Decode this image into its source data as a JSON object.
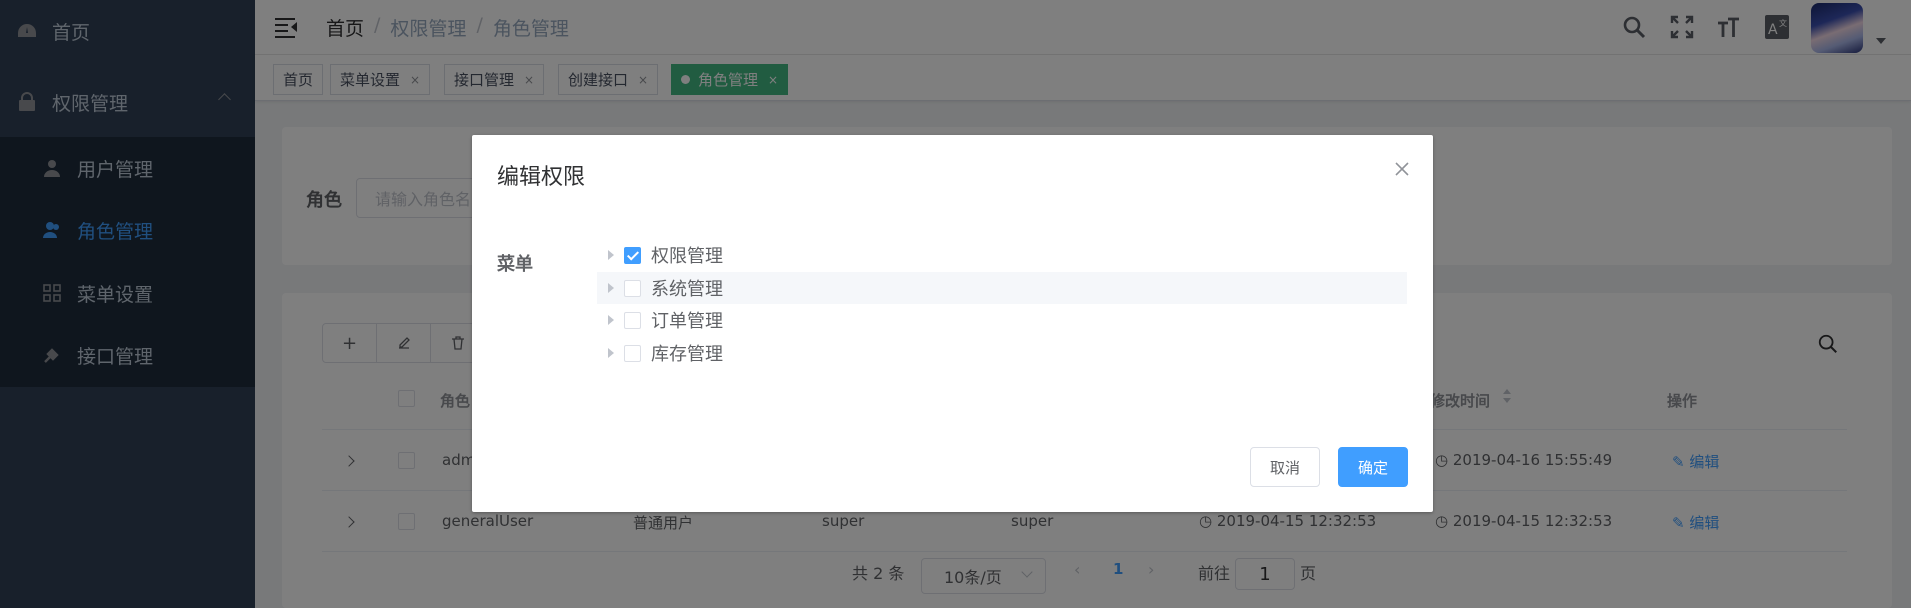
{
  "sidebar": {
    "home": {
      "label": "首页",
      "icon": "dashboard-icon"
    },
    "permission": {
      "label": "权限管理",
      "icon": "lock-icon"
    },
    "items": [
      {
        "label": "用户管理",
        "icon": "user-icon"
      },
      {
        "label": "角色管理",
        "icon": "people-icon",
        "active": true
      },
      {
        "label": "菜单设置",
        "icon": "grid-icon"
      },
      {
        "label": "接口管理",
        "icon": "api-icon"
      }
    ]
  },
  "header": {
    "breadcrumb": [
      "首页",
      "权限管理",
      "角色管理"
    ],
    "icons": [
      "search-icon",
      "fullscreen-icon",
      "font-size-icon",
      "translate-icon"
    ]
  },
  "tags": [
    {
      "label": "首页",
      "closable": false
    },
    {
      "label": "菜单设置",
      "closable": true
    },
    {
      "label": "接口管理",
      "closable": true
    },
    {
      "label": "创建接口",
      "closable": true
    },
    {
      "label": "角色管理",
      "closable": true,
      "active": true
    }
  ],
  "tag_close": "×",
  "search": {
    "label": "角色",
    "placeholder": "请输入角色名"
  },
  "table": {
    "headers": {
      "name": "角色",
      "updated": "修改时间",
      "actions": "操作"
    },
    "rows": [
      {
        "name": "admin",
        "desc": "",
        "creator": "",
        "modifier": "",
        "created": "",
        "updated": "2019-04-16 15:55:49",
        "action": "编辑"
      },
      {
        "name": "generalUser",
        "desc": "普通用户",
        "creator": "super",
        "modifier": "super",
        "created": "2019-04-15 12:32:53",
        "updated": "2019-04-15 12:32:53",
        "action": "编辑"
      }
    ]
  },
  "pagination": {
    "total": "共 2 条",
    "page_size": "10条/页",
    "current": "1",
    "goto_prefix": "前往",
    "goto_value": "1",
    "goto_suffix": "页"
  },
  "dialog": {
    "title": "编辑权限",
    "field_label": "菜单",
    "tree": [
      {
        "label": "权限管理",
        "checked": true
      },
      {
        "label": "系统管理",
        "checked": false
      },
      {
        "label": "订单管理",
        "checked": false
      },
      {
        "label": "库存管理",
        "checked": false
      }
    ],
    "cancel": "取消",
    "confirm": "确定"
  },
  "colors": {
    "primary": "#409eff",
    "sidebar_bg": "#304156",
    "active_tag": "#42b983"
  }
}
